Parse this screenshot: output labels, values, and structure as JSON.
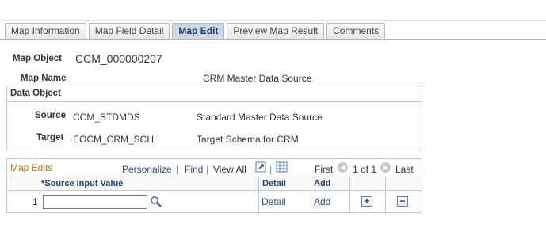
{
  "tabs": [
    {
      "label": "Map Information",
      "active": false
    },
    {
      "label": "Map Field Detail",
      "active": false
    },
    {
      "label": "Map Edit",
      "active": true
    },
    {
      "label": "Preview Map Result",
      "active": false
    },
    {
      "label": "Comments",
      "active": false
    }
  ],
  "map_object": {
    "label": "Map Object",
    "value": "CCM_000000207"
  },
  "map_name": {
    "label": "Map Name",
    "value": "CRM Master Data Source"
  },
  "data_object": {
    "title": "Data Object",
    "source": {
      "label": "Source",
      "code": "CCM_STDMDS",
      "description": "Standard Master Data Source"
    },
    "target": {
      "label": "Target",
      "code": "EOCM_CRM_SCH",
      "description": "Target Schema for CRM"
    }
  },
  "map_edits": {
    "title": "Map Edits",
    "nav": {
      "personalize": "Personalize",
      "find": "Find",
      "view_all": "View All",
      "first": "First",
      "range": "1 of 1",
      "last": "Last"
    },
    "columns": {
      "source_input": "*Source Input Value",
      "detail": "Detail",
      "add": "Add"
    },
    "rows": [
      {
        "num": "1",
        "source_input_value": "",
        "detail_link": "Detail",
        "add_link": "Add",
        "insert": "+",
        "delete": "−"
      }
    ]
  },
  "colors": {
    "accent": "#1f3e69",
    "link": "#2a4b8c",
    "grid_title": "#c76b16",
    "active_tab": "#cfd9e6"
  }
}
